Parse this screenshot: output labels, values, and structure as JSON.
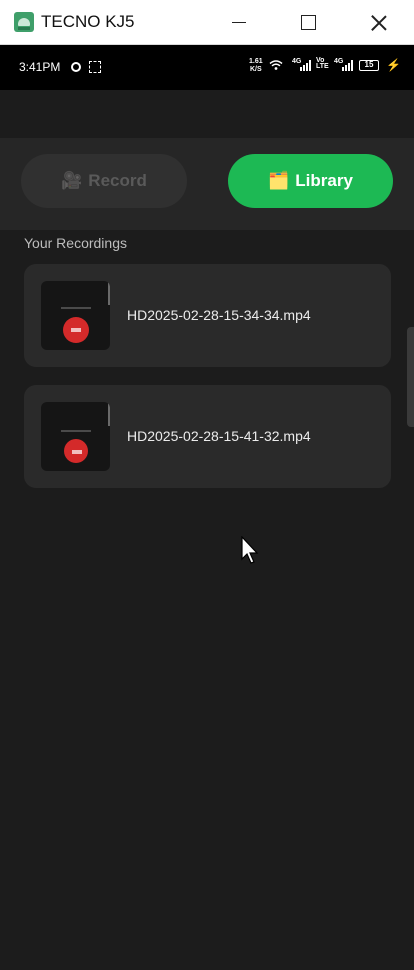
{
  "window": {
    "title": "TECNO KJ5",
    "minimize_label": "",
    "maximize_label": "",
    "close_label": ""
  },
  "status_bar": {
    "time": "3:41PM",
    "net_speed_value": "1.61",
    "net_speed_unit": "K/S",
    "signal1_label": "4G",
    "volte_label": "Vo LTE",
    "signal2_label": "4G",
    "battery": "15"
  },
  "tabs": {
    "record": {
      "icon": "🎥",
      "label": "Record"
    },
    "library": {
      "icon": "🗂️",
      "label": "Library"
    }
  },
  "library": {
    "section_title": "Your Recordings",
    "recordings": [
      {
        "filename": "HD2025-02-28-15-34-34.mp4"
      },
      {
        "filename": "HD2025-02-28-15-41-32.mp4"
      }
    ]
  },
  "colors": {
    "accent": "#1db954",
    "background": "#1c1c1c",
    "card": "#2a2a2a",
    "record_red": "#d42a2a"
  }
}
